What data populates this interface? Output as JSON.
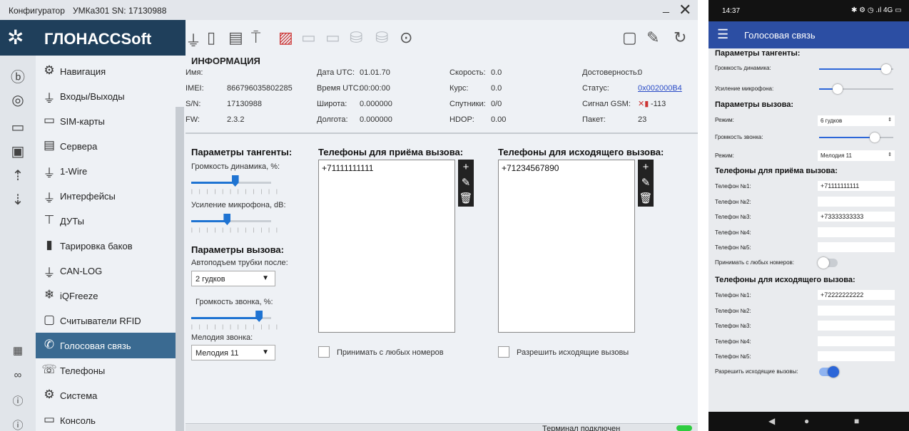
{
  "window": {
    "app": "Конфигуратор",
    "device": "УМКа301 SN: 17130988",
    "close": "✕",
    "minimize": "_"
  },
  "logo": "ГЛОНАССSoft",
  "nav": [
    {
      "label": "Навигация",
      "icon": "satellite-icon"
    },
    {
      "label": "Входы/Выходы",
      "icon": "io-icon"
    },
    {
      "label": "SIM-карты",
      "icon": "sim-icon"
    },
    {
      "label": "Сервера",
      "icon": "server-icon"
    },
    {
      "label": "1-Wire",
      "icon": "onewire-icon"
    },
    {
      "label": "Интерфейсы",
      "icon": "interface-icon"
    },
    {
      "label": "ДУТы",
      "icon": "fuel-sensor-icon"
    },
    {
      "label": "Тарировка баков",
      "icon": "tank-icon"
    },
    {
      "label": "CAN-LOG",
      "icon": "canlog-icon"
    },
    {
      "label": "iQFreeze",
      "icon": "snowflake-icon"
    },
    {
      "label": "Считыватели RFID",
      "icon": "rfid-icon"
    },
    {
      "label": "Голосовая связь",
      "icon": "phone-call-icon",
      "active": true
    },
    {
      "label": "Телефоны",
      "icon": "phone-book-icon"
    },
    {
      "label": "Система",
      "icon": "gear-icon"
    },
    {
      "label": "Консоль",
      "icon": "console-icon"
    }
  ],
  "info": {
    "title": "ИНФОРМАЦИЯ",
    "name_label": "Имя:",
    "name_value": "",
    "imei_label": "IMEI:",
    "imei_value": "866796035802285",
    "sn_label": "S/N:",
    "sn_value": "17130988",
    "fw_label": "FW:",
    "fw_value": "2.3.2",
    "utc_date_label": "Дата UTC:",
    "utc_date_value": "01.01.70",
    "utc_time_label": "Время UTC:",
    "utc_time_value": "00:00:00",
    "lat_label": "Широта:",
    "lat_value": "0.000000",
    "lon_label": "Долгота:",
    "lon_value": "0.000000",
    "speed_label": "Скорость:",
    "speed_value": "0.0",
    "course_label": "Курс:",
    "course_value": "0.0",
    "sats_label": "Спутники:",
    "sats_value": "0/0",
    "hdop_label": "HDOP:",
    "hdop_value": "0.00",
    "valid_label": "Достоверность:",
    "valid_value": "0",
    "status_label": "Статус:",
    "status_value": "0x002000B4",
    "gsm_label": "Сигнал GSM:",
    "gsm_value": "-113",
    "packet_label": "Пакет:",
    "packet_value": "23"
  },
  "ptt": {
    "title": "Параметры тангенты:",
    "speaker_label": "Громкость динамика, %:",
    "speaker_level": 0.55,
    "mic_label": "Усиление микрофона, dB:",
    "mic_level": 0.45
  },
  "call": {
    "title": "Параметры вызова:",
    "autoanswer_label": "Автоподъем трубки после:",
    "autoanswer_value": "2 гудков",
    "ring_volume_label": "Громкость звонка, %:",
    "ring_volume_level": 0.85,
    "melody_label": "Мелодия звонка:",
    "melody_value": "Мелодия 11"
  },
  "incoming": {
    "title": "Телефоны для приёма вызова:",
    "numbers": [
      "+71111111111"
    ],
    "accept_any_label": "Принимать с любых номеров",
    "accept_any": false
  },
  "outgoing": {
    "title": "Телефоны для исходящего вызова:",
    "numbers": [
      "+71234567890"
    ],
    "allow_label": "Разрешить исходящие вызовы",
    "allow": false
  },
  "statusbar": {
    "text": "Терминал подключен"
  },
  "phone": {
    "time": "14:37",
    "status_icons": "✱ ⚙ ◷ .ıl 4G ▭",
    "title": "Голосовая связь",
    "ptt_title": "Параметры тангенты:",
    "speaker_label": "Громкость динамика:",
    "speaker_level": 0.9,
    "mic_label": "Усиление микрофона:",
    "mic_level": 0.25,
    "call_title": "Параметры вызова:",
    "mode1_label": "Режим:",
    "mode1_value": "6 гудков",
    "ring_label": "Громкость звонка:",
    "ring_level": 0.75,
    "mode2_label": "Режим:",
    "mode2_value": "Мелодия 11",
    "in_title": "Телефоны для приёма вызова:",
    "in_phones": [
      {
        "label": "Телефон №1:",
        "value": "+71111111111"
      },
      {
        "label": "Телефон №2:",
        "value": ""
      },
      {
        "label": "Телефон №3:",
        "value": "+73333333333"
      },
      {
        "label": "Телефон №4:",
        "value": ""
      },
      {
        "label": "Телефон №5:",
        "value": ""
      }
    ],
    "accept_any_label": "Принимать с любых номеров:",
    "accept_any": false,
    "out_title": "Телефоны для исходящего вызова:",
    "out_phones": [
      {
        "label": "Телефон №1:",
        "value": "+72222222222"
      },
      {
        "label": "Телефон №2:",
        "value": ""
      },
      {
        "label": "Телефон №3:",
        "value": ""
      },
      {
        "label": "Телефон №4:",
        "value": ""
      },
      {
        "label": "Телефон №5:",
        "value": ""
      }
    ],
    "allow_out_label": "Разрешить исходящие вызовы:",
    "allow_out": true,
    "nav_back": "◀",
    "nav_home": "●",
    "nav_recent": "■"
  }
}
